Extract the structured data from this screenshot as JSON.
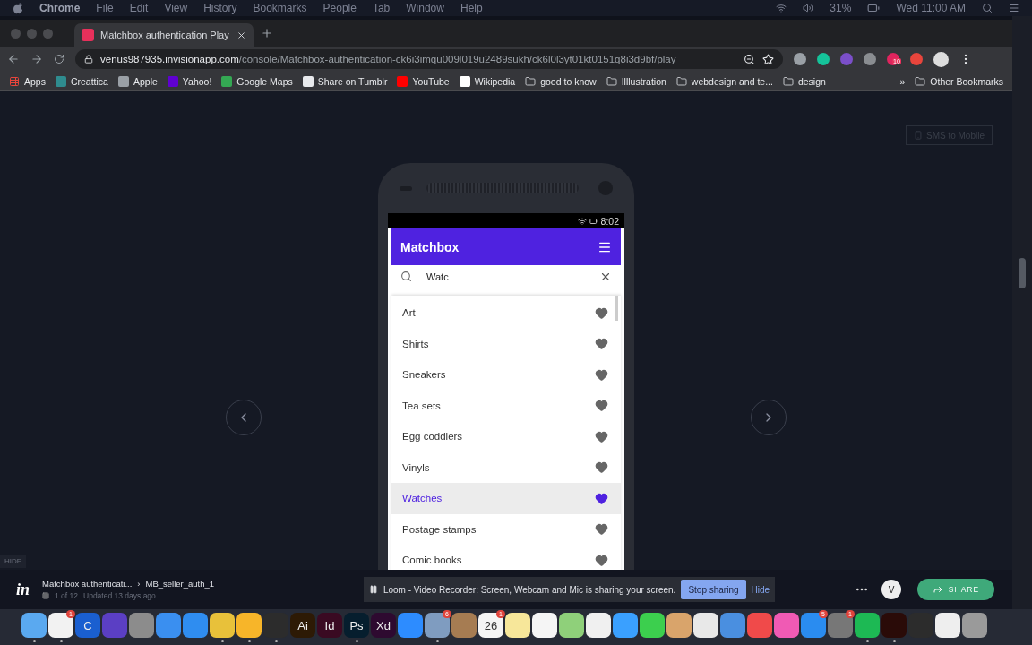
{
  "menubar": {
    "app": "Chrome",
    "menus": [
      "File",
      "Edit",
      "View",
      "History",
      "Bookmarks",
      "People",
      "Tab",
      "Window",
      "Help"
    ],
    "battery": "31%",
    "clock": "Wed 11:00 AM"
  },
  "browser": {
    "tab": {
      "title": "Matchbox authentication Play",
      "selected": true
    },
    "address": {
      "host": "venus987935.invisionapp.com",
      "path": "/console/Matchbox-authentication-ck6i3imqu009l019u2489sukh/ck6l0l3yt01kt0151q8i3d9bf/play"
    },
    "extensions": [
      {
        "color": "#9aa0a6"
      },
      {
        "color": "#15c39a"
      },
      {
        "color": "#7b4fc9"
      },
      {
        "color": "#8a8d91"
      },
      {
        "color": "#e0245e",
        "badge": "10"
      },
      {
        "color": "#e8453c"
      }
    ],
    "bookmarks": [
      {
        "kind": "apps",
        "label": "Apps"
      },
      {
        "kind": "site",
        "label": "Creattica",
        "color": "#2f8c8f"
      },
      {
        "kind": "site",
        "label": "Apple",
        "color": "#9aa0a6"
      },
      {
        "kind": "site",
        "label": "Yahoo!",
        "color": "#5f01d1"
      },
      {
        "kind": "site",
        "label": "Google Maps",
        "color": "#34a853"
      },
      {
        "kind": "site",
        "label": "Share on Tumblr",
        "color": "#e8eaed"
      },
      {
        "kind": "site",
        "label": "YouTube",
        "color": "#ff0000"
      },
      {
        "kind": "site",
        "label": "Wikipedia",
        "color": "#ffffff"
      },
      {
        "kind": "folder",
        "label": "good to know"
      },
      {
        "kind": "folder",
        "label": "Illlustration"
      },
      {
        "kind": "folder",
        "label": "webdesign and te..."
      },
      {
        "kind": "folder",
        "label": "design"
      }
    ],
    "overflow": "»",
    "other_bookmarks": "Other Bookmarks"
  },
  "stage": {
    "sms_button": {
      "label": "SMS to Mobile",
      "disabled": true
    },
    "hide_label": "HIDE",
    "phone": {
      "time": "8:02",
      "app_title": "Matchbox",
      "search": {
        "value": "Watc"
      },
      "items": [
        {
          "label": "Art",
          "selected": false
        },
        {
          "label": "Shirts",
          "selected": false
        },
        {
          "label": "Sneakers",
          "selected": false
        },
        {
          "label": "Tea sets",
          "selected": false
        },
        {
          "label": "Egg coddlers",
          "selected": false
        },
        {
          "label": "Vinyls",
          "selected": false
        },
        {
          "label": "Watches",
          "selected": true
        },
        {
          "label": "Postage stamps",
          "selected": false
        },
        {
          "label": "Comic books",
          "selected": false
        }
      ]
    }
  },
  "footer": {
    "logo": "in",
    "project": "Matchbox authenticati...",
    "separator": "›",
    "screen": "MB_seller_auth_1",
    "count": "1 of 12",
    "updated": "Updated 13 days ago",
    "loom": {
      "message": "Loom - Video Recorder: Screen, Webcam and Mic is sharing your screen.",
      "stop": "Stop sharing",
      "hide": "Hide"
    },
    "avatar": "V",
    "share": "SHARE"
  },
  "dock": [
    {
      "color": "#5aa9f0",
      "running": true
    },
    {
      "color": "#f2f2f2",
      "running": true,
      "badge": "1"
    },
    {
      "color": "#1a5fd0",
      "label": "C",
      "running": false
    },
    {
      "color": "#5b3fc4",
      "running": false
    },
    {
      "color": "#8c8c8c",
      "running": false
    },
    {
      "color": "#3a8ff0",
      "running": false
    },
    {
      "color": "#2f8df0",
      "running": false
    },
    {
      "color": "#e8c13a",
      "running": true
    },
    {
      "color": "#f7b529",
      "running": true
    },
    {
      "color": "#2c2c2c",
      "running": true
    },
    {
      "color": "#2d1a05",
      "label": "Ai",
      "running": false
    },
    {
      "color": "#3a0a22",
      "label": "Id",
      "running": false
    },
    {
      "color": "#061e2e",
      "label": "Ps",
      "running": true
    },
    {
      "color": "#2e0a30",
      "label": "Xd",
      "running": false
    },
    {
      "color": "#2d8cff",
      "running": false
    },
    {
      "color": "#7f9cc0",
      "running": true,
      "badge": "6"
    },
    {
      "color": "#a67c52",
      "running": false
    },
    {
      "color": "#f5f5f5",
      "label": "26",
      "running": false,
      "badge": "1"
    },
    {
      "color": "#f7e79a",
      "running": false
    },
    {
      "color": "#f5f5f5",
      "running": false
    },
    {
      "color": "#8fd07a",
      "running": false
    },
    {
      "color": "#f0f0f0",
      "running": false
    },
    {
      "color": "#3aa0ff",
      "running": false
    },
    {
      "color": "#3ccf4e",
      "running": false
    },
    {
      "color": "#d9a46b",
      "running": false
    },
    {
      "color": "#e8e8e8",
      "running": false
    },
    {
      "color": "#4a8fe0",
      "running": false
    },
    {
      "color": "#f04a4a",
      "running": false
    },
    {
      "color": "#f05ab4",
      "running": false
    },
    {
      "color": "#2a8cf0",
      "running": false,
      "badge": "5"
    },
    {
      "color": "#777777",
      "running": false,
      "badge": "1"
    },
    {
      "color": "#1db954",
      "running": true
    },
    {
      "color": "#2a0b08",
      "running": true
    },
    {
      "color": "#2c2c2c",
      "running": false
    },
    {
      "color": "#eeeeee",
      "running": false
    },
    {
      "color": "#9a9a9a",
      "running": false
    }
  ]
}
